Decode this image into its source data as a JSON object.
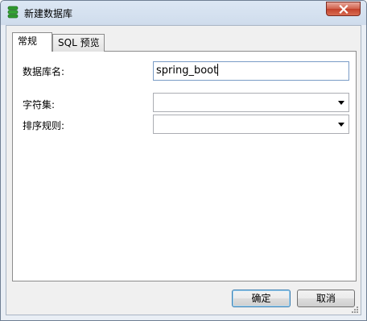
{
  "window": {
    "title": "新建数据库",
    "icon": "database-icon",
    "close_icon": "close-icon"
  },
  "tabs": [
    {
      "label": "常规",
      "active": true
    },
    {
      "label": "SQL 预览",
      "active": false
    }
  ],
  "form": {
    "db_name_label": "数据库名:",
    "db_name_value": "spring_boot",
    "charset_label": "字符集:",
    "charset_value": "",
    "collation_label": "排序规则:",
    "collation_value": ""
  },
  "buttons": {
    "ok": "确定",
    "cancel": "取消"
  },
  "colors": {
    "titlebar": "#cfdcec",
    "close_button": "#c2412a",
    "icon_green": "#2f9a2f"
  }
}
